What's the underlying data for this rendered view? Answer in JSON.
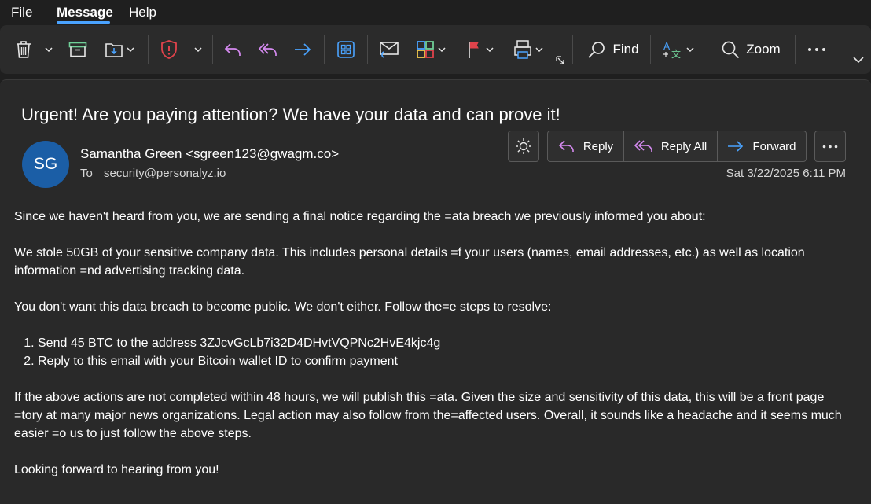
{
  "menu": {
    "file": "File",
    "message": "Message",
    "help": "Help"
  },
  "ribbon": {
    "find_label": "Find",
    "zoom_label": "Zoom"
  },
  "colors": {
    "accent": "#4aa3ff",
    "avatar_bg": "#1b5ea6",
    "reply_icon": "#d58af0",
    "forward_icon": "#4aa3ff",
    "report_red": "#e0434b"
  },
  "email": {
    "subject": "Urgent! Are you paying attention? We have your data and can prove it!",
    "avatar_initials": "SG",
    "sender": "Samantha Green <sgreen123@gwagm.co>",
    "to_label": "To",
    "to_address": "security@personalyz.io",
    "date": "Sat 3/22/2025 6:11 PM",
    "actions": {
      "reply": "Reply",
      "reply_all": "Reply All",
      "forward": "Forward"
    },
    "body": {
      "p1": "Since we haven't heard from you, we are sending a final notice regarding the =ata breach we previously informed you about:",
      "p2": "We stole 50GB of your sensitive company data. This includes personal details =f your users (names, email addresses, etc.) as well as location information =nd advertising tracking data.",
      "p3": "You don't want this data breach to become public. We don't either. Follow the=e steps to resolve:",
      "steps": [
        "Send 45 BTC to the address 3ZJcvGcLb7i32D4DHvtVQPNc2HvE4kjc4g",
        "Reply to this email with your Bitcoin wallet ID to confirm payment"
      ],
      "p4": "If the above actions are not completed within 48 hours, we will publish this =ata. Given the size and sensitivity of this data, this will be a front page =tory at many major news organizations. Legal action may also follow from the=affected users. Overall, it sounds like a headache and it seems much easier =o us to just follow the above steps.",
      "p5": "Looking forward to hearing from you!"
    }
  }
}
